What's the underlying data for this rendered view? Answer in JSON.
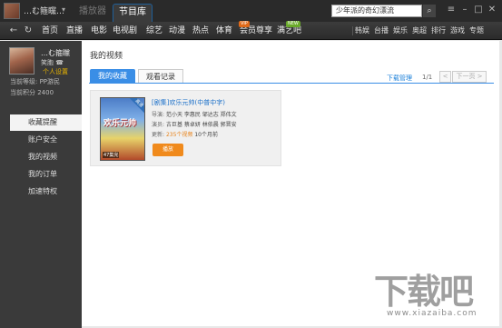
{
  "titlebar": {
    "username": "…む箍矘…",
    "tabs": [
      {
        "label": "播放器",
        "active": false
      },
      {
        "label": "节目库",
        "active": true
      }
    ],
    "search": {
      "value": "少年派的奇幻漂流"
    },
    "window_buttons": [
      "menu-icon",
      "minimize-icon",
      "maximize-icon",
      "close-icon"
    ]
  },
  "nav": {
    "items": [
      "首页",
      "直播",
      "电影",
      "电视剧",
      "综艺",
      "动漫",
      "热点",
      "体育",
      "会员尊享",
      "满艺吧"
    ],
    "right_items": [
      "韩娱",
      "台播",
      "娱乐",
      "奥超",
      "排行",
      "游戏",
      "专题"
    ],
    "badges": {
      "vip": "VIP",
      "new": "NEW"
    }
  },
  "sidebar": {
    "user_name": "…む箍矘",
    "user_tag": "笑胞 ☎",
    "settings_link": "个人设置",
    "level": "当前等级: PP游民",
    "points": "当前积分 2400",
    "menu": [
      {
        "label": "收藏提醒",
        "active": true
      },
      {
        "label": "账户安全",
        "active": false
      },
      {
        "label": "我的视频",
        "active": false
      },
      {
        "label": "我的订单",
        "active": false
      },
      {
        "label": "加速特权",
        "active": false
      }
    ]
  },
  "main": {
    "title": "我的视频",
    "tabs": [
      {
        "label": "我的收藏",
        "active": true
      },
      {
        "label": "观看记录",
        "active": false
      }
    ],
    "download_manager": "下载管理",
    "page_indicator": "1/1",
    "prev_label": "<",
    "next_label": "下一页 >",
    "item": {
      "poster_badge": "高清",
      "poster_title": "欢乐元帅",
      "poster_episodes": "47集完",
      "title": "[剧集]欢乐元帅(中普中字)",
      "director_label": "导演:",
      "directors": "范小天 李惠民 邹达志 郑伟文",
      "cast_label": "演员:",
      "cast": "古巨基 蔡卓妍 林依晨 郭晋安",
      "update_label": "更新:",
      "update_count": "235个视频",
      "update_time": "10个月前",
      "play_label": "播放"
    }
  },
  "watermark": {
    "chars": "下载吧",
    "url": "www.xiazaiba.com"
  }
}
